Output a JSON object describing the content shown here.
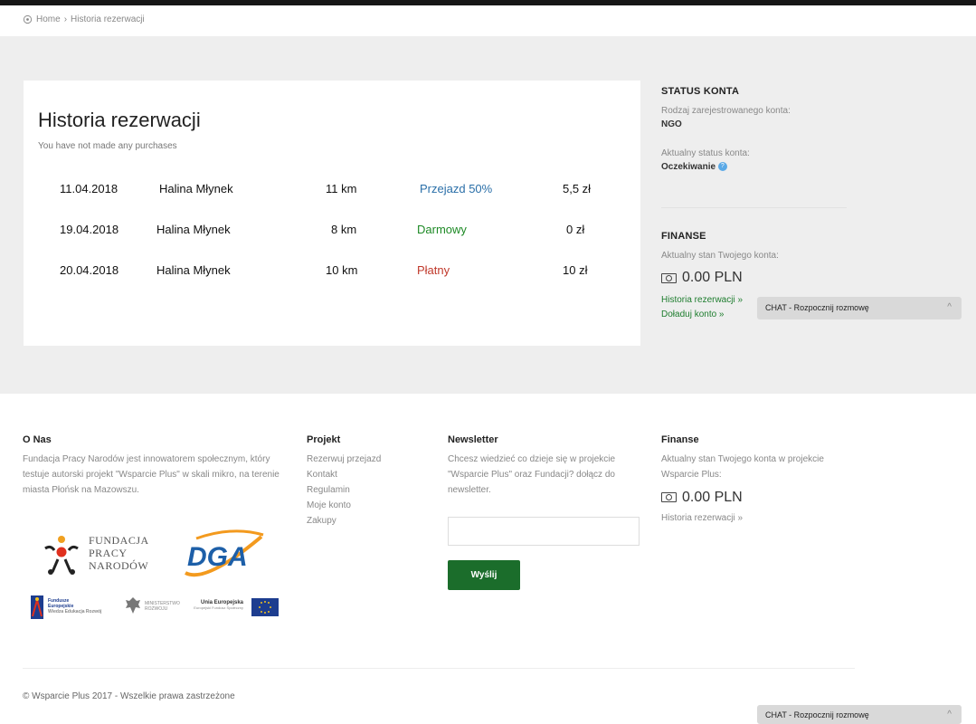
{
  "breadcrumb": {
    "home": "Home",
    "separator": "›",
    "current": "Historia rezerwacji"
  },
  "history": {
    "title": "Historia rezerwacji",
    "subtitle": "You have not made any purchases",
    "rows": [
      {
        "date": "11.04.2018",
        "name": "Halina Młynek",
        "distance": "11 km",
        "type": "Przejazd 50%",
        "type_status": "discount",
        "price": "5,5 zł"
      },
      {
        "date": "19.04.2018",
        "name": "Halina Młynek",
        "distance": "8 km",
        "type": "Darmowy",
        "type_status": "free",
        "price": "0 zł"
      },
      {
        "date": "20.04.2018",
        "name": "Halina Młynek",
        "distance": "10 km",
        "type": "Płatny",
        "type_status": "paid",
        "price": "10 zł"
      }
    ]
  },
  "sidebar": {
    "status_heading": "STATUS KONTA",
    "account_type_label": "Rodzaj zarejestrowanego konta:",
    "account_type_value": "NGO",
    "account_status_label": "Aktualny status konta:",
    "account_status_value": "Oczekiwanie",
    "info_icon": "?",
    "finance_heading": "FINANSE",
    "balance_label": "Aktualny stan Twojego konta:",
    "balance_value": "0.00 PLN",
    "history_link": "Historia rezerwacji »",
    "topup_link": "Doładuj konto »"
  },
  "chat": {
    "label": "CHAT - Rozpocznij rozmowę",
    "chevron": "^"
  },
  "footer": {
    "about": {
      "heading": "O Nas",
      "text": "Fundacja Pracy Narodów jest innowatorem społecznym, który testuje autorski projekt \"Wsparcie Plus\" w skali mikro, na terenie miasta Płońsk na Mazowszu."
    },
    "project": {
      "heading": "Projekt",
      "links": [
        "Rezerwuj przejazd",
        "Kontakt",
        "Regulamin",
        "Moje konto",
        "Zakupy"
      ]
    },
    "newsletter": {
      "heading": "Newsletter",
      "text": "Chcesz wiedzieć co dzieje się w projekcie \"Wsparcie Plus\" oraz Fundacji? dołącz do newsletter.",
      "input_placeholder": "",
      "button": "Wyślij"
    },
    "finance": {
      "heading": "Finanse",
      "text": "Aktualny stan Twojego konta w projekcie Wsparcie Plus:",
      "balance": "0.00 PLN",
      "link": "Historia rezerwacji »"
    },
    "logos": {
      "fpn": [
        "FUNDACJA",
        "PRACY",
        "NARODÓW"
      ],
      "dga": "DGA",
      "eu_funds": [
        "Fundusze",
        "Europejskie",
        "Wiedza Edukacja Rozwój"
      ],
      "ministry": [
        "MINISTERSTWO",
        "ROZWOJU"
      ],
      "eu_union": [
        "Unia Europejska",
        "Europejski Fundusz Społeczny"
      ]
    },
    "copyright": "© Wsparcie Plus 2017 - Wszelkie prawa zastrzeżone"
  },
  "colors": {
    "accent_green": "#1b6d2b",
    "link_green": "#1e7d2e",
    "status_blue": "#2a6fa8",
    "status_green": "#1e8a26",
    "status_red": "#c0392b",
    "dga_blue": "#1d5fa8",
    "dga_orange": "#f39a1e"
  }
}
